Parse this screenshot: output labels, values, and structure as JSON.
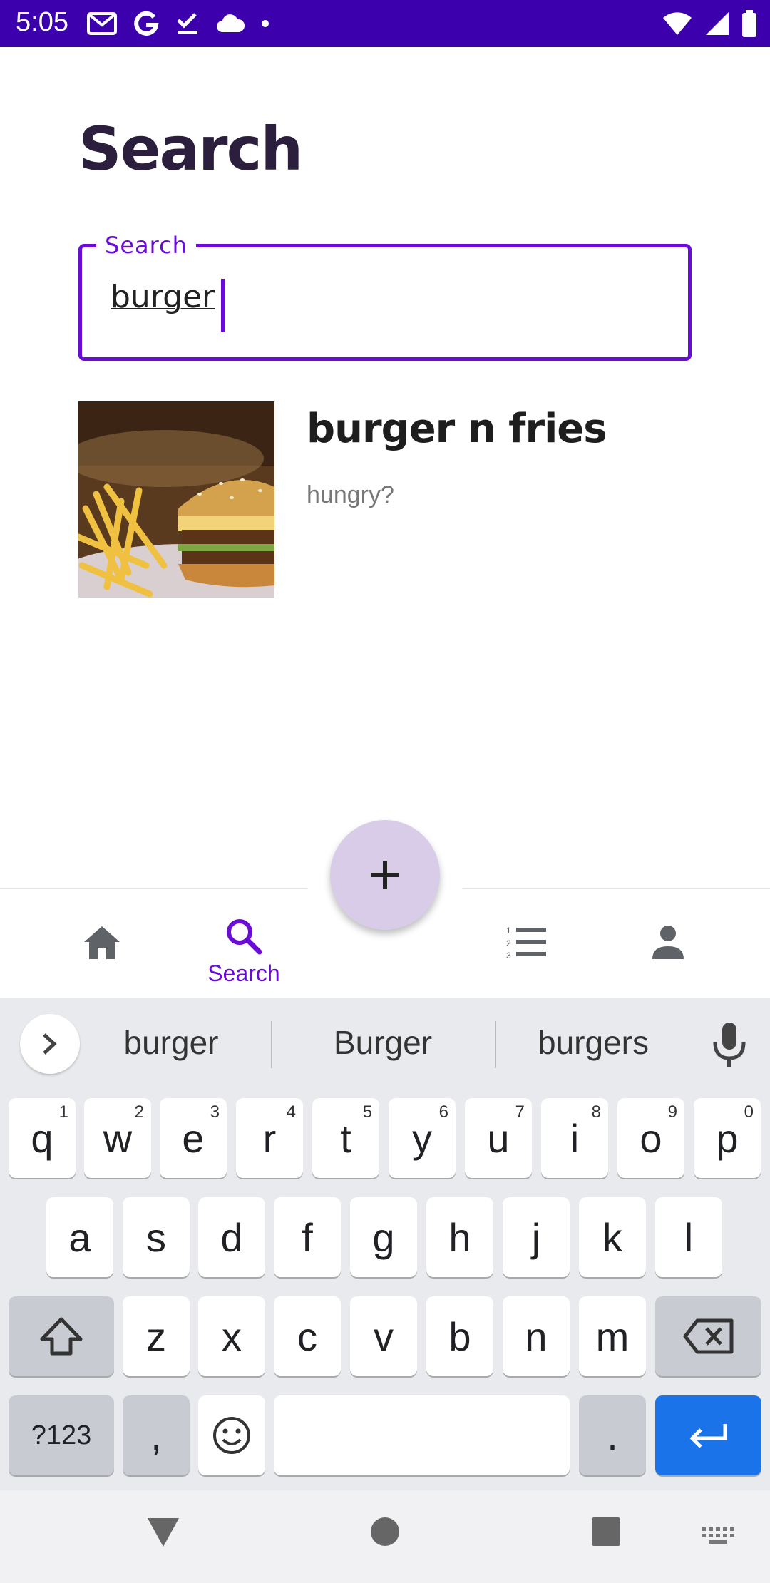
{
  "status_bar": {
    "time": "5:05",
    "left_icons": [
      "gmail-icon",
      "google-icon",
      "tasks-check-icon",
      "cloud-icon",
      "dot-icon"
    ],
    "right_icons": [
      "wifi-icon",
      "signal-icon",
      "battery-icon"
    ]
  },
  "page": {
    "title": "Search"
  },
  "search": {
    "label": "Search",
    "value": "burger"
  },
  "results": [
    {
      "title": "burger n fries",
      "subtitle": "hungry?"
    }
  ],
  "bottom_nav": {
    "items": [
      {
        "icon": "home-icon",
        "label": "",
        "active": false
      },
      {
        "icon": "search-icon",
        "label": "Search",
        "active": true
      },
      {
        "icon": "list-icon",
        "label": "",
        "active": false
      },
      {
        "icon": "person-icon",
        "label": "",
        "active": false
      }
    ],
    "fab_icon": "plus-icon"
  },
  "keyboard": {
    "suggestions": [
      "burger",
      "Burger",
      "burgers"
    ],
    "row1": [
      {
        "k": "q",
        "h": "1"
      },
      {
        "k": "w",
        "h": "2"
      },
      {
        "k": "e",
        "h": "3"
      },
      {
        "k": "r",
        "h": "4"
      },
      {
        "k": "t",
        "h": "5"
      },
      {
        "k": "y",
        "h": "6"
      },
      {
        "k": "u",
        "h": "7"
      },
      {
        "k": "i",
        "h": "8"
      },
      {
        "k": "o",
        "h": "9"
      },
      {
        "k": "p",
        "h": "0"
      }
    ],
    "row2": [
      "a",
      "s",
      "d",
      "f",
      "g",
      "h",
      "j",
      "k",
      "l"
    ],
    "row3": [
      "z",
      "x",
      "c",
      "v",
      "b",
      "n",
      "m"
    ],
    "symbols_label": "?123",
    "comma": ",",
    "period": "."
  },
  "colors": {
    "status_bar": "#3d00ad",
    "accent": "#6a0cd6",
    "fab": "#d8cce8",
    "enter_key": "#1a73e8"
  }
}
